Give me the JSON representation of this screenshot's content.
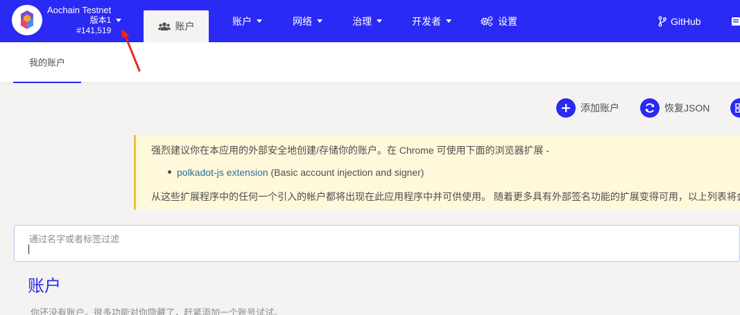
{
  "chain": {
    "name": "Aochain Testnet",
    "version": "版本1",
    "block": "#141,519"
  },
  "nav": {
    "active_label": "账户",
    "items": [
      {
        "label": "账户",
        "has_caret": true
      },
      {
        "label": "网络",
        "has_caret": true
      },
      {
        "label": "治理",
        "has_caret": true
      },
      {
        "label": "开发者",
        "has_caret": true
      },
      {
        "label": "设置",
        "has_caret": false
      }
    ],
    "github_label": "GitHub"
  },
  "subtabs": {
    "my_accounts": "我的账户"
  },
  "actions": {
    "add_account": "添加账户",
    "restore_json": "恢复JSON"
  },
  "banner": {
    "line1": "强烈建议你在本应用的外部安全地创建/存储你的账户。在 Chrome 可使用下面的浏览器扩展 -",
    "link_text": "polkadot-js extension",
    "link_suffix": " (Basic account injection and signer)",
    "line3": "从这些扩展程序中的任何一个引入的帐户都将出现在此应用程序中并可供使用。 随着更多具有外部签名功能的扩展变得可用，以上列表将会"
  },
  "filter": {
    "placeholder": "通过名字或者标签过滤"
  },
  "accounts": {
    "title": "账户",
    "empty_text": "你还没有账户。很多功能对你隐藏了，赶紧添加一个账号试试。"
  },
  "colors": {
    "primary": "#2b29f4",
    "banner_bg": "#fff8da",
    "banner_border": "#f3c335",
    "annotation": "#e8261c"
  }
}
